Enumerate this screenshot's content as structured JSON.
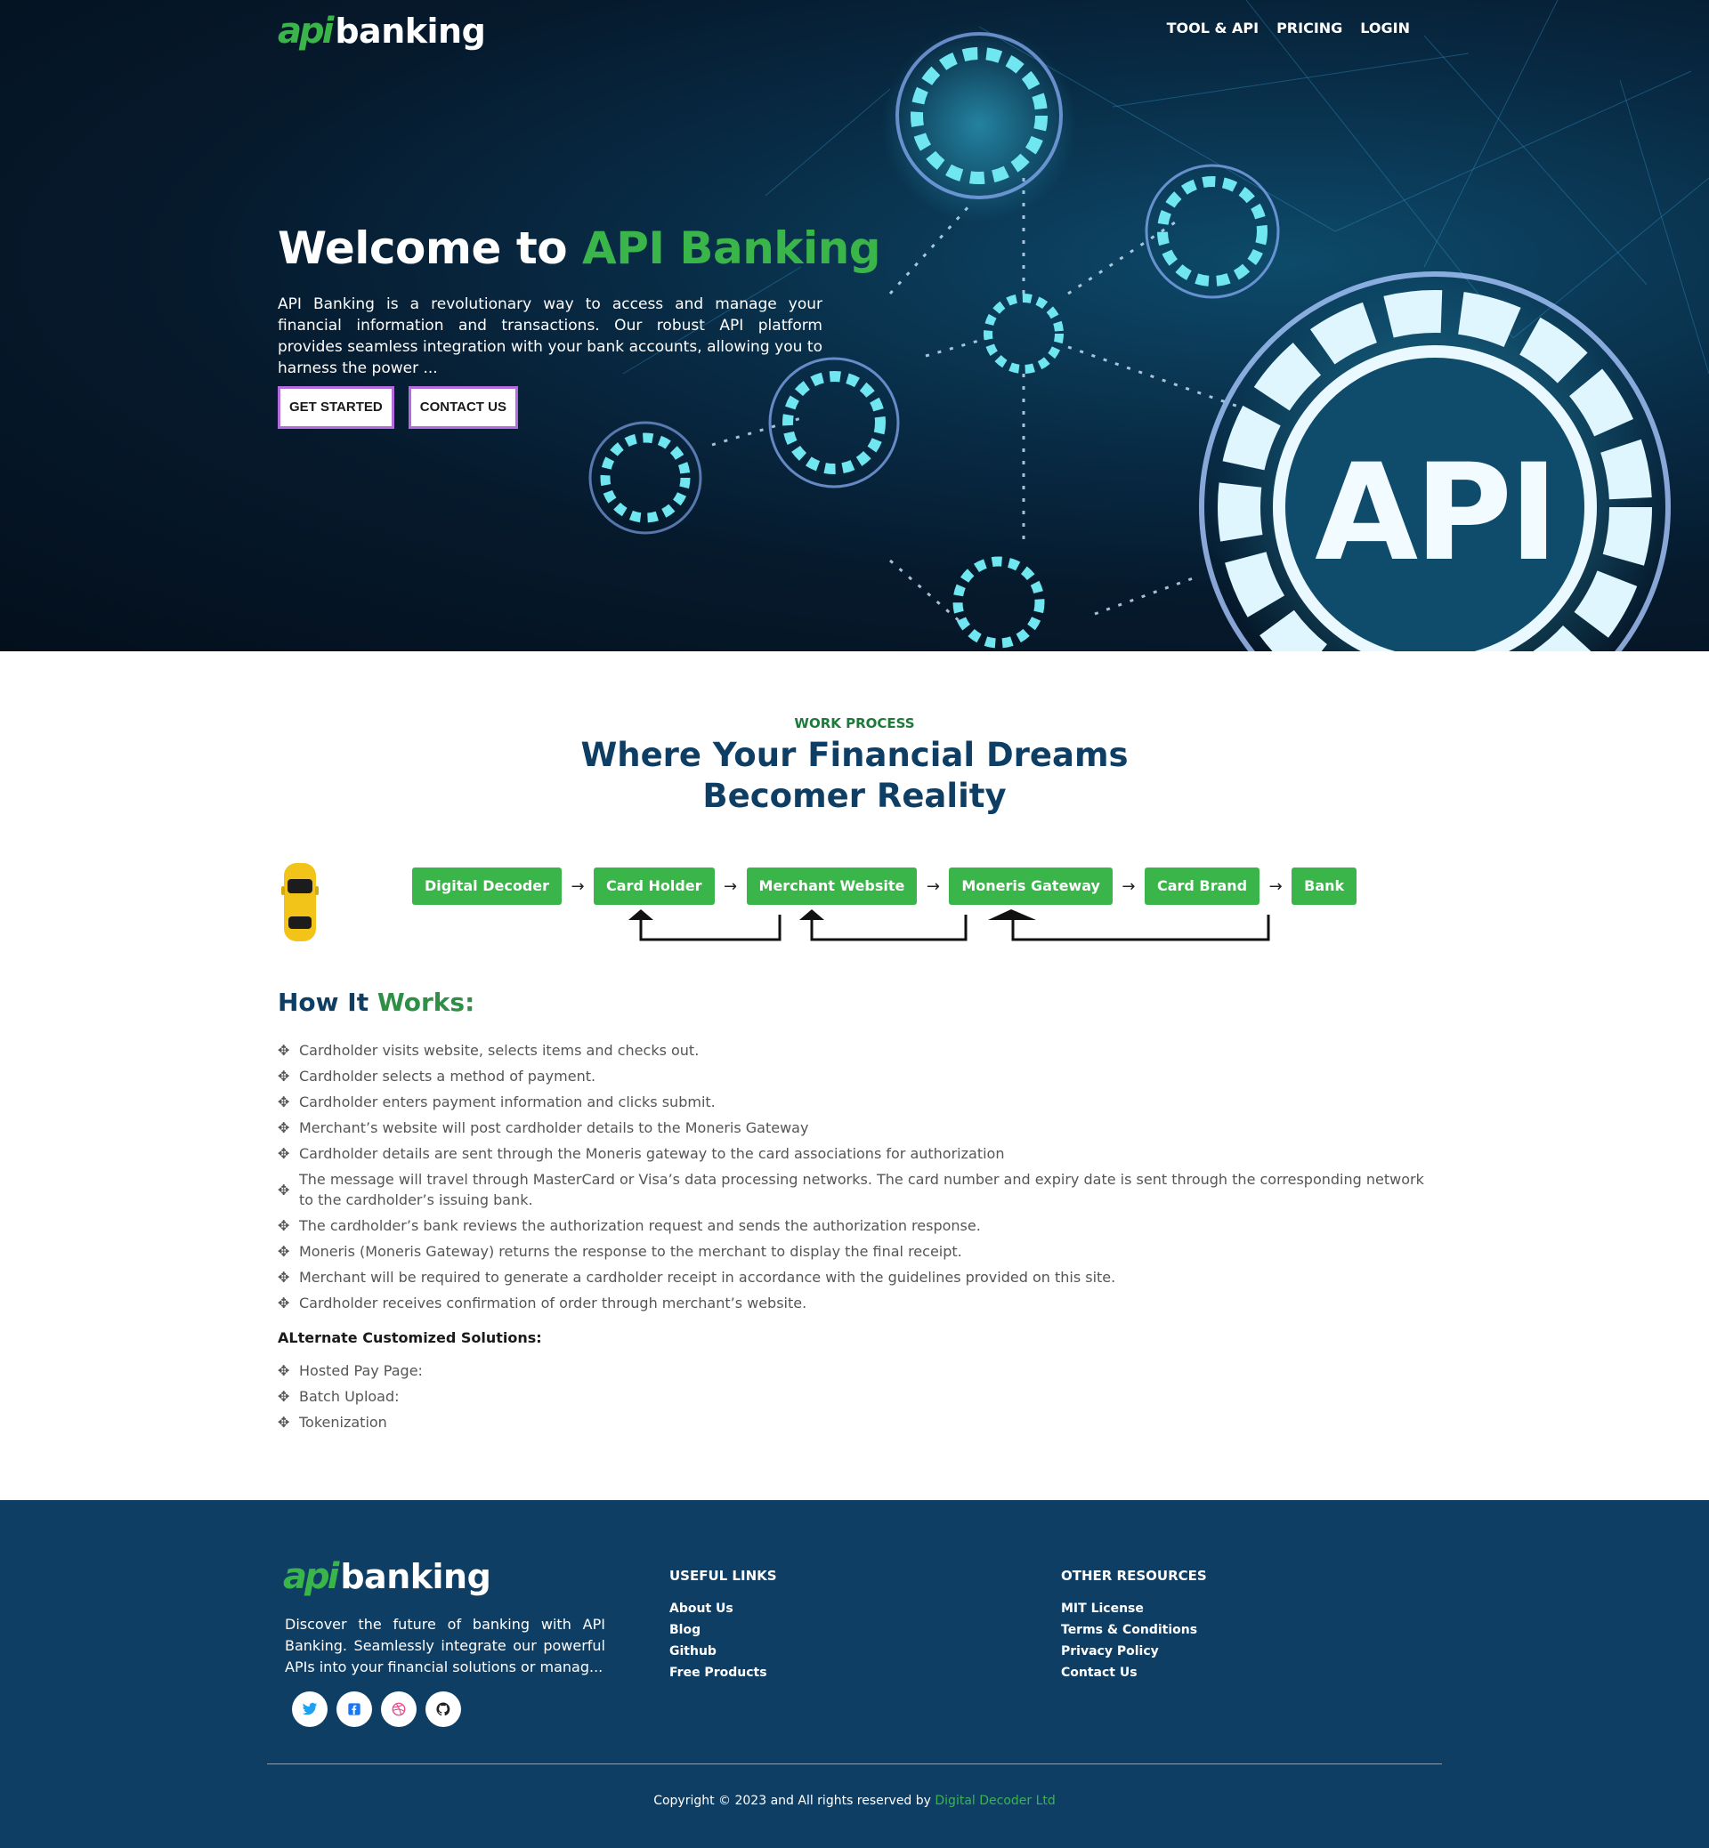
{
  "brand": {
    "mark": "api",
    "word": "banking"
  },
  "nav": [
    {
      "label": "TOOL & API"
    },
    {
      "label": "PRICING"
    },
    {
      "label": "LOGIN"
    }
  ],
  "hero": {
    "title_prefix": "Welcome to ",
    "title_accent": "API Banking",
    "text": "API Banking is a revolutionary way to access and manage your financial information and transactions. Our robust API platform provides seamless integration with your bank accounts, allowing you to harness the power ...",
    "buttons": [
      {
        "label": "GET STARTED"
      },
      {
        "label": "CONTACT US"
      }
    ],
    "art_text": "API"
  },
  "process": {
    "eyebrow": "WORK PROCESS",
    "title_line1": "Where Your Financial Dreams",
    "title_line2": "Becomer Reality",
    "steps": [
      {
        "label": "Digital Decoder"
      },
      {
        "label": "Card Holder"
      },
      {
        "label": "Merchant Website"
      },
      {
        "label": "Moneris Gateway"
      },
      {
        "label": "Card Brand"
      },
      {
        "label": "Bank"
      }
    ],
    "arrow": "→"
  },
  "how": {
    "title_prefix": "How It ",
    "title_accent": "Works:",
    "steps": [
      "Cardholder visits website, selects items and checks out.",
      "Cardholder selects a method of payment.",
      "Cardholder enters payment information and clicks submit.",
      "Merchant’s website will post cardholder details to the Moneris Gateway",
      "Cardholder details are sent through the Moneris gateway to the card associations for authorization",
      "The message will travel through MasterCard or Visa’s data processing networks. The card number and expiry date is sent through the corresponding network to the cardholder’s issuing bank.",
      "The cardholder’s bank reviews the authorization request and sends the authorization response.",
      "Moneris (Moneris Gateway) returns the response to the merchant to display the final receipt.",
      "Merchant will be required to generate a cardholder receipt in accordance with the guidelines provided on this site.",
      "Cardholder receives confirmation of order through merchant’s website."
    ],
    "alt_title": "ALternate Customized Solutions:",
    "alternates": [
      "Hosted Pay Page:",
      "Batch Upload:",
      "Tokenization"
    ],
    "bullet_icon": "move-arrows-icon"
  },
  "footer": {
    "about": "Discover the future of banking with API Banking. Seamlessly integrate our powerful APIs into your financial solutions or manag...",
    "socials": [
      {
        "icon": "twitter-icon",
        "color": "#1da1f2"
      },
      {
        "icon": "facebook-icon",
        "color": "#1877f2"
      },
      {
        "icon": "dribbble-icon",
        "color": "#ea4c89"
      },
      {
        "icon": "github-icon",
        "color": "#222222"
      }
    ],
    "useful_title": "USEFUL LINKS",
    "useful_links": [
      "About Us",
      "Blog",
      "Github",
      "Free Products"
    ],
    "other_title": "OTHER RESOURCES",
    "other_links": [
      "MIT License",
      "Terms & Conditions",
      "Privacy Policy",
      "Contact Us"
    ],
    "copyright_prefix": "Copyright © 2023 and All rights reserved by ",
    "copyright_link": "Digital Decoder Ltd"
  },
  "colors": {
    "accent": "#3ab54a",
    "navy": "#0f3e64",
    "hero_bg": "#061a2d",
    "button_border": "#b46be0"
  }
}
